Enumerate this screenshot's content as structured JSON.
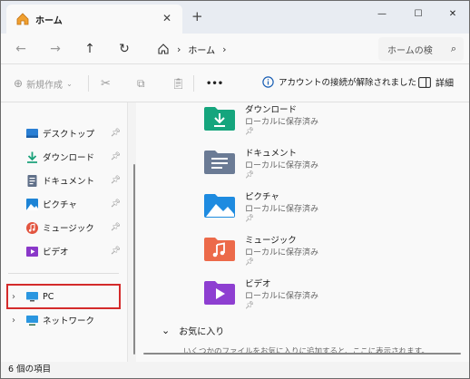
{
  "window": {
    "tab_title": "ホーム",
    "new_tab": "+",
    "controls": {
      "minimize": "—",
      "maximize": "☐",
      "close": "✕"
    }
  },
  "navbar": {
    "location": "ホーム",
    "search_placeholder": "ホームの検",
    "icons": [
      "back-icon",
      "forward-icon",
      "up-icon",
      "refresh-icon",
      "home-icon",
      "search-icon"
    ]
  },
  "toolbar": {
    "new_label": "新規作成",
    "more_label": "•••",
    "notice": "アカウントの接続が解除されました",
    "details_label": "詳細"
  },
  "sidebar": {
    "quick_items": [
      {
        "label": "デスクトップ",
        "icon": "desktop-icon",
        "color": "#2a7fd4"
      },
      {
        "label": "ダウンロード",
        "icon": "download-icon",
        "color": "#1aa17a"
      },
      {
        "label": "ドキュメント",
        "icon": "document-icon",
        "color": "#607089"
      },
      {
        "label": "ピクチャ",
        "icon": "pictures-icon",
        "color": "#1d84d6"
      },
      {
        "label": "ミュージック",
        "icon": "music-icon",
        "color": "#e2543f"
      },
      {
        "label": "ビデオ",
        "icon": "video-icon",
        "color": "#8a38c9"
      }
    ],
    "pc_label": "PC",
    "network_label": "ネットワーク"
  },
  "main": {
    "folders": [
      {
        "name": "ダウンロード",
        "location": "ローカルに保存済み",
        "icon": "download-folder-icon",
        "color": "#15a57d"
      },
      {
        "name": "ドキュメント",
        "location": "ローカルに保存済み",
        "icon": "documents-folder-icon",
        "color": "#6b7b95"
      },
      {
        "name": "ピクチャ",
        "location": "ローカルに保存済み",
        "icon": "pictures-folder-icon",
        "color": "#1e8be0"
      },
      {
        "name": "ミュージック",
        "location": "ローカルに保存済み",
        "icon": "music-folder-icon",
        "color": "#ec6a4a"
      },
      {
        "name": "ビデオ",
        "location": "ローカルに保存済み",
        "icon": "video-folder-icon",
        "color": "#8e3fd1"
      }
    ],
    "favorites_label": "お気に入り",
    "favorites_desc": "いくつかのファイルをお気に入りに追加すると、ここに表示されます。"
  },
  "status": {
    "item_count": "6 個の項目"
  }
}
